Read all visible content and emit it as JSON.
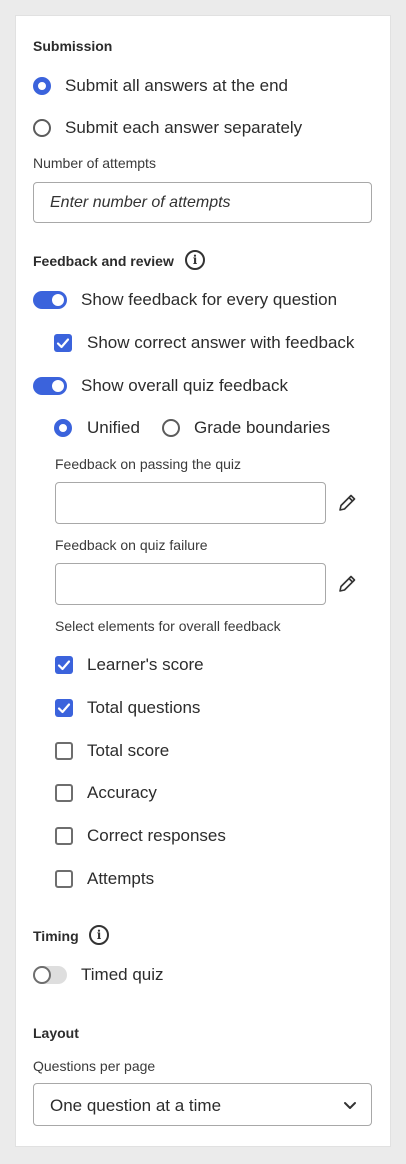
{
  "submission": {
    "title": "Submission",
    "option_all": "Submit all answers at the end",
    "option_each": "Submit each answer separately",
    "attempts_label": "Number of attempts",
    "attempts_placeholder": "Enter number of attempts"
  },
  "feedback": {
    "title": "Feedback and review",
    "show_every_question": "Show feedback for every question",
    "show_correct_answer": "Show correct answer with feedback",
    "show_overall": "Show overall quiz feedback",
    "unified": "Unified",
    "grade_boundaries": "Grade boundaries",
    "passing_label": "Feedback on passing the quiz",
    "failure_label": "Feedback on quiz failure",
    "elements_label": "Select elements for overall feedback",
    "elements": [
      {
        "label": "Learner's score",
        "checked": true
      },
      {
        "label": "Total questions",
        "checked": true
      },
      {
        "label": "Total score",
        "checked": false
      },
      {
        "label": "Accuracy",
        "checked": false
      },
      {
        "label": "Correct responses",
        "checked": false
      },
      {
        "label": "Attempts",
        "checked": false
      }
    ]
  },
  "timing": {
    "title": "Timing",
    "timed_quiz": "Timed quiz"
  },
  "layout": {
    "title": "Layout",
    "questions_label": "Questions per page",
    "questions_value": "One question at a time"
  },
  "colors": {
    "accent": "#3b63dc",
    "panel": "#ffffff",
    "background": "#ebebeb"
  }
}
